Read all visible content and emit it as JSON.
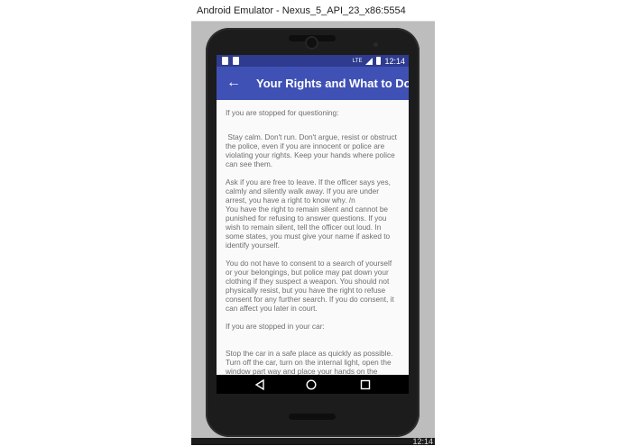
{
  "window": {
    "title": "Android Emulator - Nexus_5_API_23_x86:5554",
    "host_clock": "12:14"
  },
  "status_bar": {
    "network": "LTE",
    "time": "12:14"
  },
  "app_bar": {
    "title": "Your Rights and What to Do:",
    "back_icon": "arrow-left-icon"
  },
  "content": {
    "paragraphs": [
      "If you are stopped for questioning:",
      " Stay calm. Don't run. Don't argue, resist or obstruct the police, even if you are innocent or police are violating your rights. Keep your hands where police can see them.",
      "Ask if you are free to leave. If the officer says yes, calmly and silently walk away. If you are under arrest, you have a right to know why. /n\nYou have the right to remain silent and cannot be punished for refusing to answer questions. If you wish to remain silent, tell the officer out loud. In some states, you must give your name if asked to identify yourself.",
      "You do not have to consent to a search of yourself or your belongings, but police may pat down your clothing if they suspect a weapon. You should not physically resist, but you have the right to refuse consent for any further search. If you do consent, it can affect you later in court.",
      "If you are stopped in your car:",
      "Stop the car in a safe place as quickly as possible. Turn off the car, turn on the internal light, open the window part way and place your hands on the wheel."
    ]
  },
  "nav_bar": {
    "icons": [
      "back-triangle-icon",
      "home-circle-icon",
      "recents-square-icon"
    ]
  },
  "colors": {
    "primary": "#3f51b5",
    "primary_dark": "#2f3b8f",
    "body_text": "#6e6e6e"
  }
}
